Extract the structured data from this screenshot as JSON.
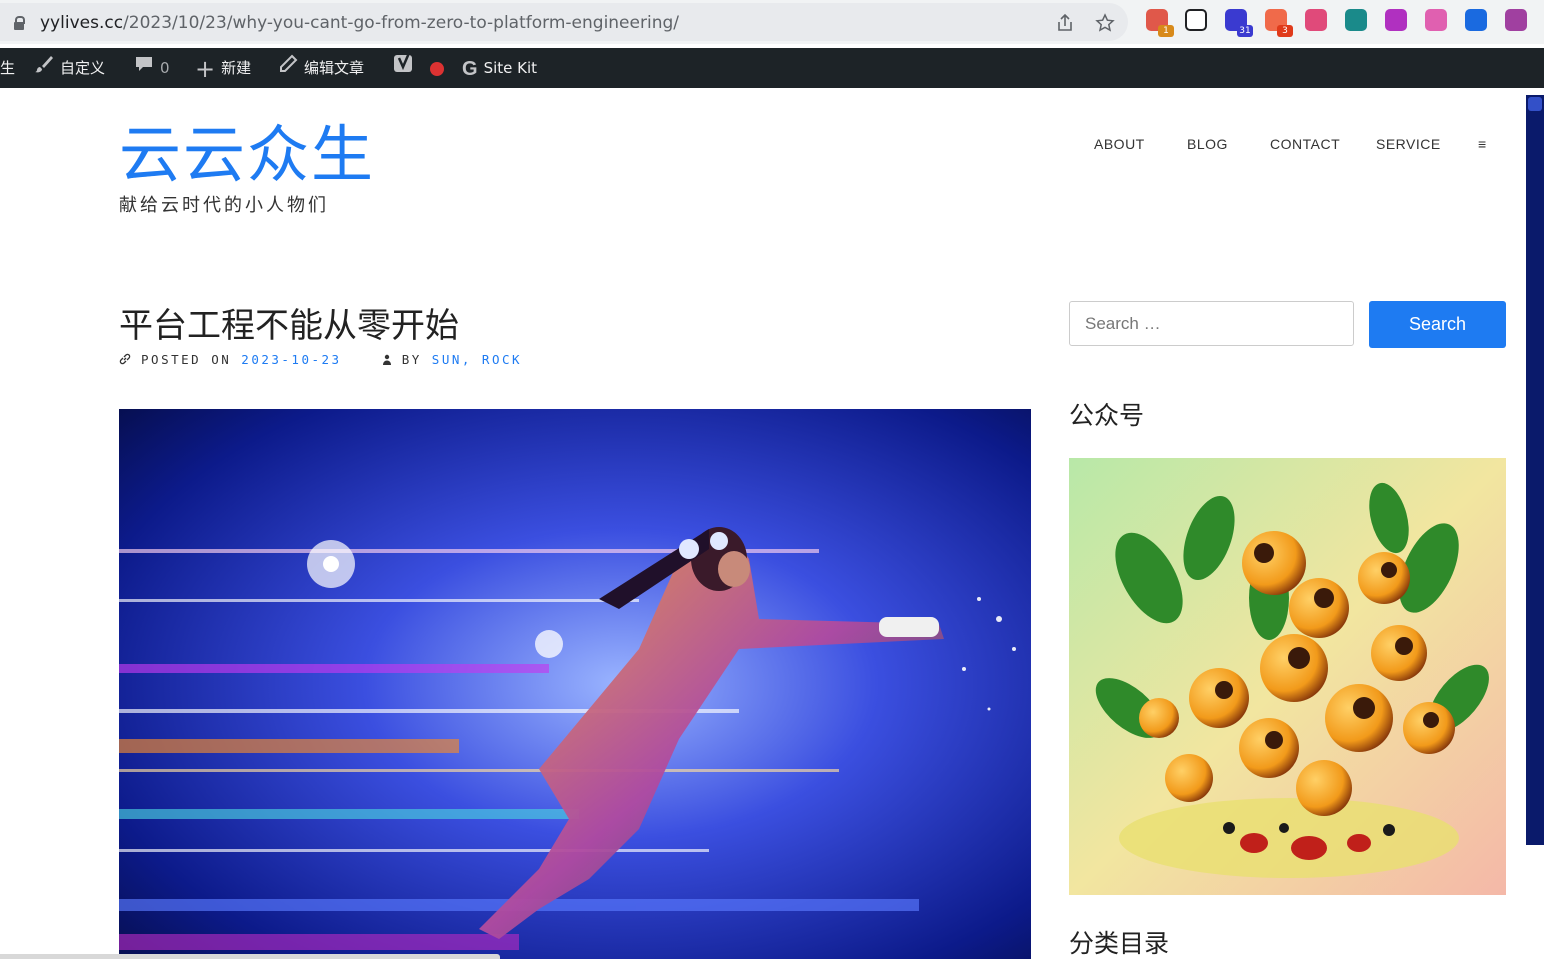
{
  "browser": {
    "url_host": "yylives.cc",
    "url_path": "/2023/10/23/why-you-cant-go-from-zero-to-platform-engineering/",
    "icons": [
      "lock-icon",
      "share-icon",
      "star-icon"
    ],
    "extensions": [
      {
        "name": "extension-icon-1",
        "color": "#e0584a",
        "badge": "1",
        "badge_color": "#d88a1a"
      },
      {
        "name": "notion-extension-icon",
        "color": "#ffffff"
      },
      {
        "name": "extension-icon-graduation",
        "color": "#3a3ad0",
        "badge": "31",
        "badge_color": "#3a3ad0"
      },
      {
        "name": "extension-icon-3",
        "color": "#f06a4a",
        "badge": "3",
        "badge_color": "#e03a1a"
      },
      {
        "name": "translate-extension-icon",
        "color": "#e04a7a"
      },
      {
        "name": "extension-icon-grid",
        "color": "#1a8a8a"
      },
      {
        "name": "extension-icon-purple",
        "color": "#b030c0"
      },
      {
        "name": "extension-icon-cloud",
        "color": "#e060b0"
      },
      {
        "name": "extension-icon-blue",
        "color": "#1a6ae0"
      },
      {
        "name": "openai-extension-icon",
        "color": "#a040a0"
      }
    ]
  },
  "admin_bar": {
    "site_fragment": "生",
    "customize": "自定义",
    "comments_count": "0",
    "new": "新建",
    "edit_post": "编辑文章",
    "sitekit": "Site Kit"
  },
  "site": {
    "title": "云云众生",
    "description": "献给云时代的小人物们"
  },
  "nav": {
    "items": [
      "ABOUT",
      "BLOG",
      "CONTACT",
      "SERVICE"
    ],
    "menu_icon": "≡"
  },
  "post": {
    "title": "平台工程不能从零开始",
    "posted_on_label": "POSTED ON",
    "date": "2023-10-23",
    "by_label": "BY",
    "author": "SUN, ROCK"
  },
  "sidebar": {
    "search_placeholder": "Search …",
    "search_button": "Search",
    "widget1_title": "公众号",
    "widget2_title": "分类目录"
  }
}
